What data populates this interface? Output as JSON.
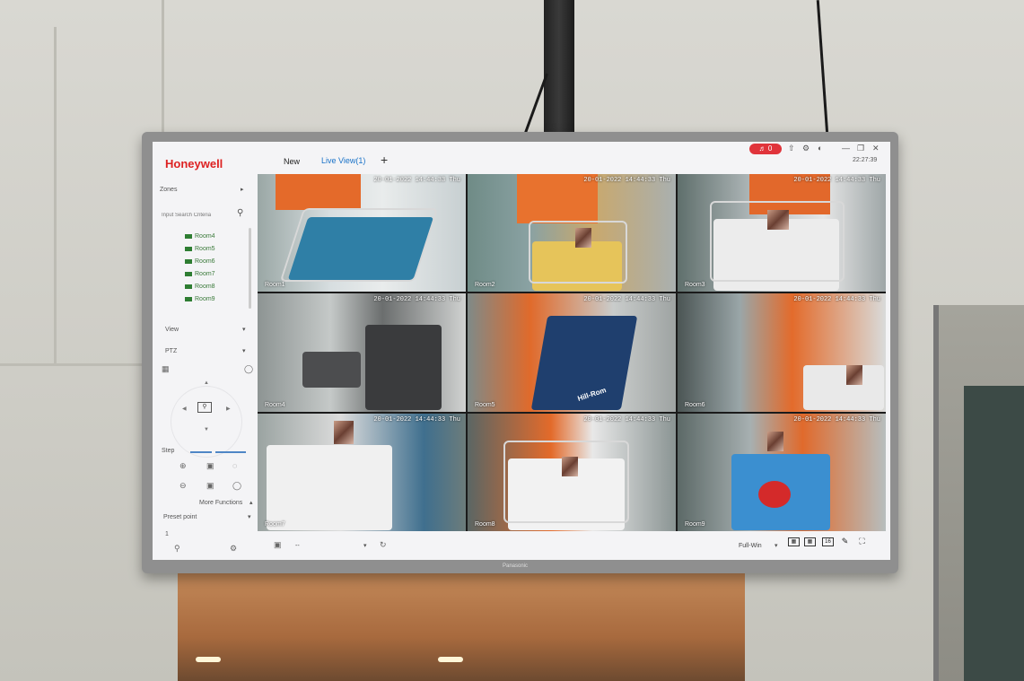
{
  "app": {
    "logo": "Honeywell",
    "tabs": [
      {
        "label": "New"
      },
      {
        "label": "Live View(1)"
      }
    ],
    "add_tab": "+",
    "alarm_count": "0",
    "clock": "22:27:39",
    "monitor_brand": "Panasonic"
  },
  "sidebar": {
    "zones_label": "Zones",
    "search_placeholder": "Input Search Criteria",
    "cameras": [
      {
        "label": "Room4"
      },
      {
        "label": "Room5"
      },
      {
        "label": "Room6"
      },
      {
        "label": "Room7"
      },
      {
        "label": "Room8"
      },
      {
        "label": "Room9"
      }
    ],
    "view_label": "View",
    "ptz_label": "PTZ",
    "step_label": "Step",
    "more_functions_label": "More Functions",
    "preset_label": "Preset point",
    "preset_value": "1"
  },
  "tiles": [
    {
      "label": "Room1",
      "stamp": "20-01-2022 14:44:33 Thu"
    },
    {
      "label": "Room2",
      "stamp": "20-01-2022 14:44:33 Thu"
    },
    {
      "label": "Room3",
      "stamp": "20-01-2022 14:44:33 Thu"
    },
    {
      "label": "Room4",
      "stamp": "20-01-2022 14:44:33 Thu"
    },
    {
      "label": "Room5",
      "stamp": "20-01-2022 14:44:33 Thu"
    },
    {
      "label": "Room6",
      "stamp": "20-01-2022 14:44:33 Thu"
    },
    {
      "label": "Room7",
      "stamp": "20-01-2022 14:44:33 Thu"
    },
    {
      "label": "Room8",
      "stamp": "20-01-2022 14:44:33 Thu"
    },
    {
      "label": "Room9",
      "stamp": "20-01-2022 14:44:33 Thu"
    }
  ],
  "tile_overlay_text": {
    "hill_rom": "Hill-Rom"
  },
  "bottom": {
    "stream_value": "--",
    "window_mode": "Full-Win",
    "layout_16": "16"
  },
  "colors": {
    "brand": "#dd2222",
    "accent": "#1a73c8",
    "alarm": "#e0343b"
  }
}
